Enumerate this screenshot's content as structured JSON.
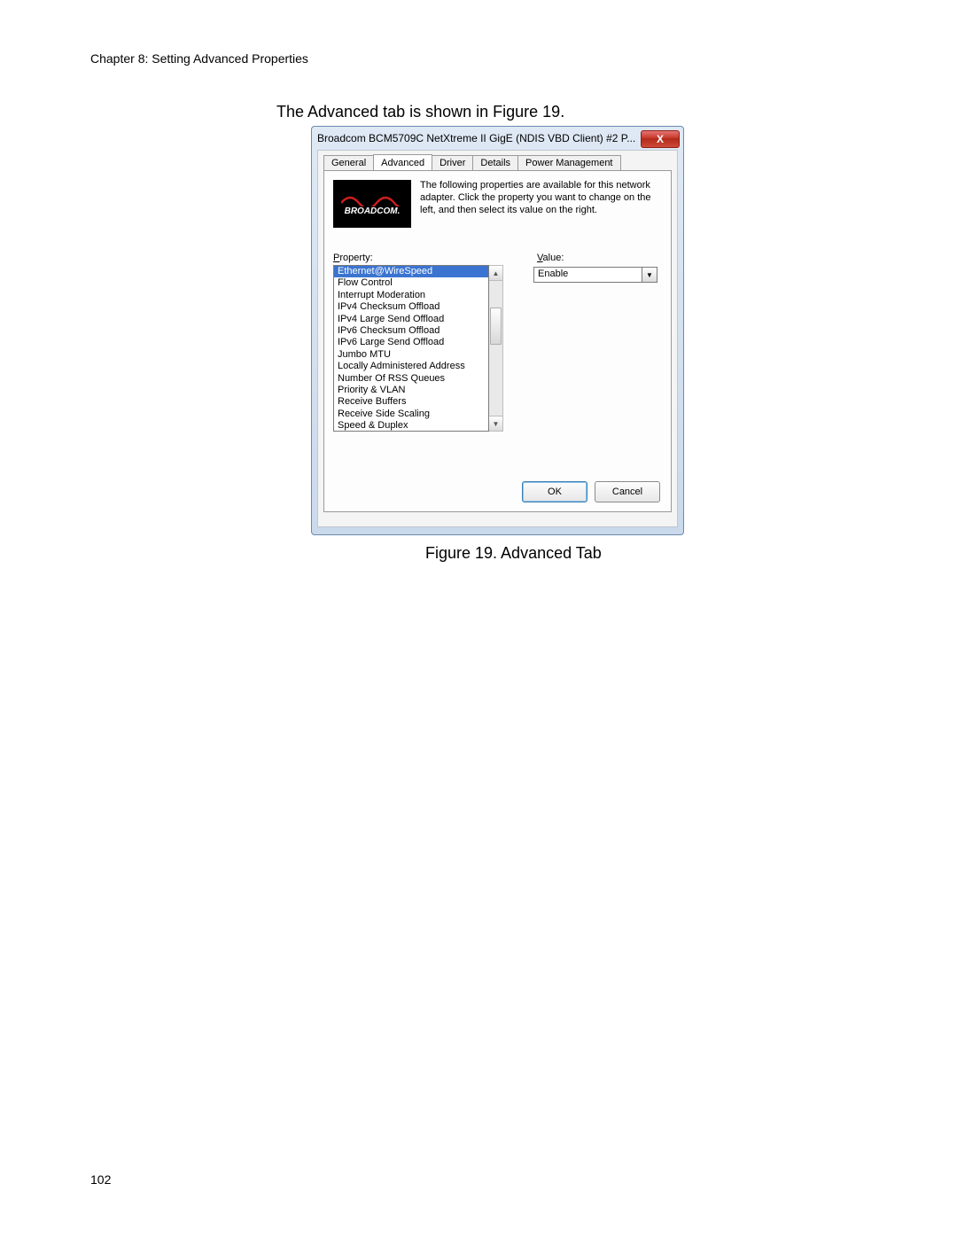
{
  "doc": {
    "chapter_header": "Chapter 8: Setting Advanced Properties",
    "lead_text": "The Advanced tab is shown in Figure 19.",
    "figure_caption": "Figure 19. Advanced Tab",
    "page_number": "102"
  },
  "dialog": {
    "title": "Broadcom BCM5709C NetXtreme II GigE (NDIS VBD Client) #2 P...",
    "close_symbol": "X",
    "tabs": {
      "general": "General",
      "advanced": "Advanced",
      "driver": "Driver",
      "details": "Details",
      "power": "Power Management"
    },
    "logo_text": "BROADCOM.",
    "description": "The following properties are available for this network adapter. Click the property you want to change on the left, and then select its value on the right.",
    "labels": {
      "property": "Property:",
      "value": "Value:"
    },
    "properties": [
      "Ethernet@WireSpeed",
      "Flow Control",
      "Interrupt Moderation",
      "IPv4 Checksum Offload",
      "IPv4 Large Send Offload",
      "IPv6 Checksum Offload",
      "IPv6 Large Send Offload",
      "Jumbo MTU",
      "Locally Administered Address",
      "Number Of RSS Queues",
      "Priority & VLAN",
      "Receive Buffers",
      "Receive Side Scaling",
      "Speed & Duplex"
    ],
    "selected_property_index": 0,
    "value_selected": "Enable",
    "buttons": {
      "ok": "OK",
      "cancel": "Cancel"
    }
  }
}
